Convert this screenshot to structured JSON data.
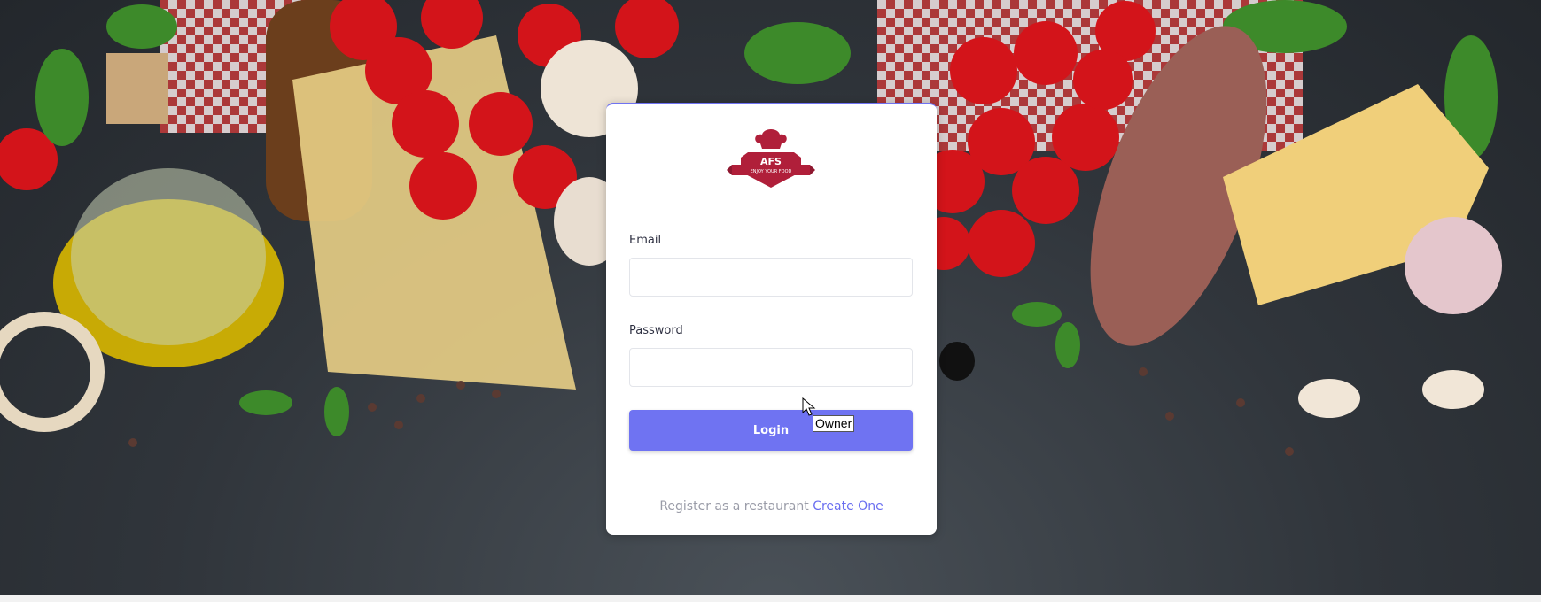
{
  "logo": {
    "brand": "AFS",
    "tagline": "ENJOY YOUR FOOD",
    "icon": "chef-hat-icon",
    "color": "#b01f3a"
  },
  "form": {
    "email_label": "Email",
    "email_value": "",
    "password_label": "Password",
    "password_value": "",
    "login_label": "Login"
  },
  "register": {
    "text": "Register as a restaurant",
    "link": "Create One"
  },
  "tooltip": {
    "text": "Owner"
  },
  "colors": {
    "accent": "#6f73f2",
    "link": "#6a6ef0",
    "muted_text": "#9a9ca8"
  }
}
